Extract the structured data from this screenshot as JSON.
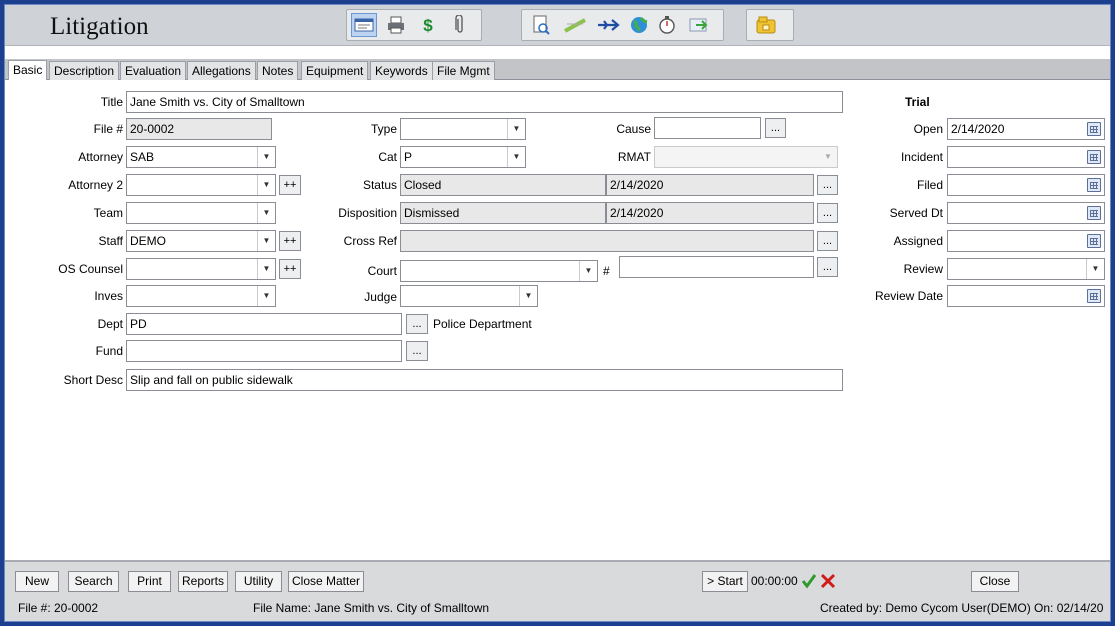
{
  "app": {
    "title": "Litigation"
  },
  "tabs": [
    "Basic",
    "Description",
    "Evaluation",
    "Allegations",
    "Notes",
    "Equipment",
    "Keywords",
    "File Mgmt"
  ],
  "form": {
    "title": {
      "label": "Title",
      "value": "Jane Smith vs. City of Smalltown"
    },
    "file_no": {
      "label": "File #",
      "value": "20-0002"
    },
    "attorney": {
      "label": "Attorney",
      "value": "SAB"
    },
    "attorney2": {
      "label": "Attorney 2",
      "value": ""
    },
    "team": {
      "label": "Team",
      "value": ""
    },
    "staff": {
      "label": "Staff",
      "value": "DEMO"
    },
    "os_counsel": {
      "label": "OS Counsel",
      "value": ""
    },
    "inves": {
      "label": "Inves",
      "value": ""
    },
    "dept": {
      "label": "Dept",
      "value": "PD",
      "description": "Police Department"
    },
    "fund": {
      "label": "Fund",
      "value": ""
    },
    "short_desc": {
      "label": "Short Desc",
      "value": "Slip and fall on public sidewalk"
    },
    "type": {
      "label": "Type",
      "value": ""
    },
    "cat": {
      "label": "Cat",
      "value": "P"
    },
    "status": {
      "label": "Status",
      "value": "Closed",
      "date": "2/14/2020"
    },
    "disposition": {
      "label": "Disposition",
      "value": "Dismissed",
      "date": "2/14/2020"
    },
    "cross_ref": {
      "label": "Cross Ref",
      "value": ""
    },
    "court": {
      "label": "Court",
      "value": "",
      "number_label": "#",
      "number": ""
    },
    "judge": {
      "label": "Judge",
      "value": ""
    },
    "cause": {
      "label": "Cause",
      "value": ""
    },
    "rmat": {
      "label": "RMAT",
      "value": ""
    },
    "ellipsis": "...",
    "plusplus": "++"
  },
  "trial": {
    "heading": "Trial",
    "open": {
      "label": "Open",
      "value": "2/14/2020"
    },
    "incident": {
      "label": "Incident",
      "value": ""
    },
    "filed": {
      "label": "Filed",
      "value": ""
    },
    "served_dt": {
      "label": "Served Dt",
      "value": ""
    },
    "assigned": {
      "label": "Assigned",
      "value": ""
    },
    "review": {
      "label": "Review",
      "value": ""
    },
    "review_date": {
      "label": "Review Date",
      "value": ""
    }
  },
  "bottom": {
    "new": "New",
    "search": "Search",
    "print": "Print",
    "reports": "Reports",
    "utility": "Utility",
    "close_matter": "Close Matter",
    "start": "> Start",
    "timer": "00:00:00",
    "close": "Close"
  },
  "status": {
    "file_no": "File #: 20-0002",
    "file_name": "File Name: Jane Smith vs. City of Smalltown",
    "created": "Created by: Demo Cycom User(DEMO) On: 02/14/20"
  },
  "toolbar_icons": [
    "details-icon",
    "print-icon",
    "dollar-icon",
    "paperclip-icon",
    "preview-icon",
    "ruler-icon",
    "plane-icon",
    "globe-icon",
    "stopwatch-icon",
    "export-icon",
    "folder-icon"
  ],
  "colors": {
    "frame": "#1d3f8f",
    "accent": "#bcd4f2",
    "check": "#2e9a2e",
    "cancel": "#d11a1a"
  }
}
